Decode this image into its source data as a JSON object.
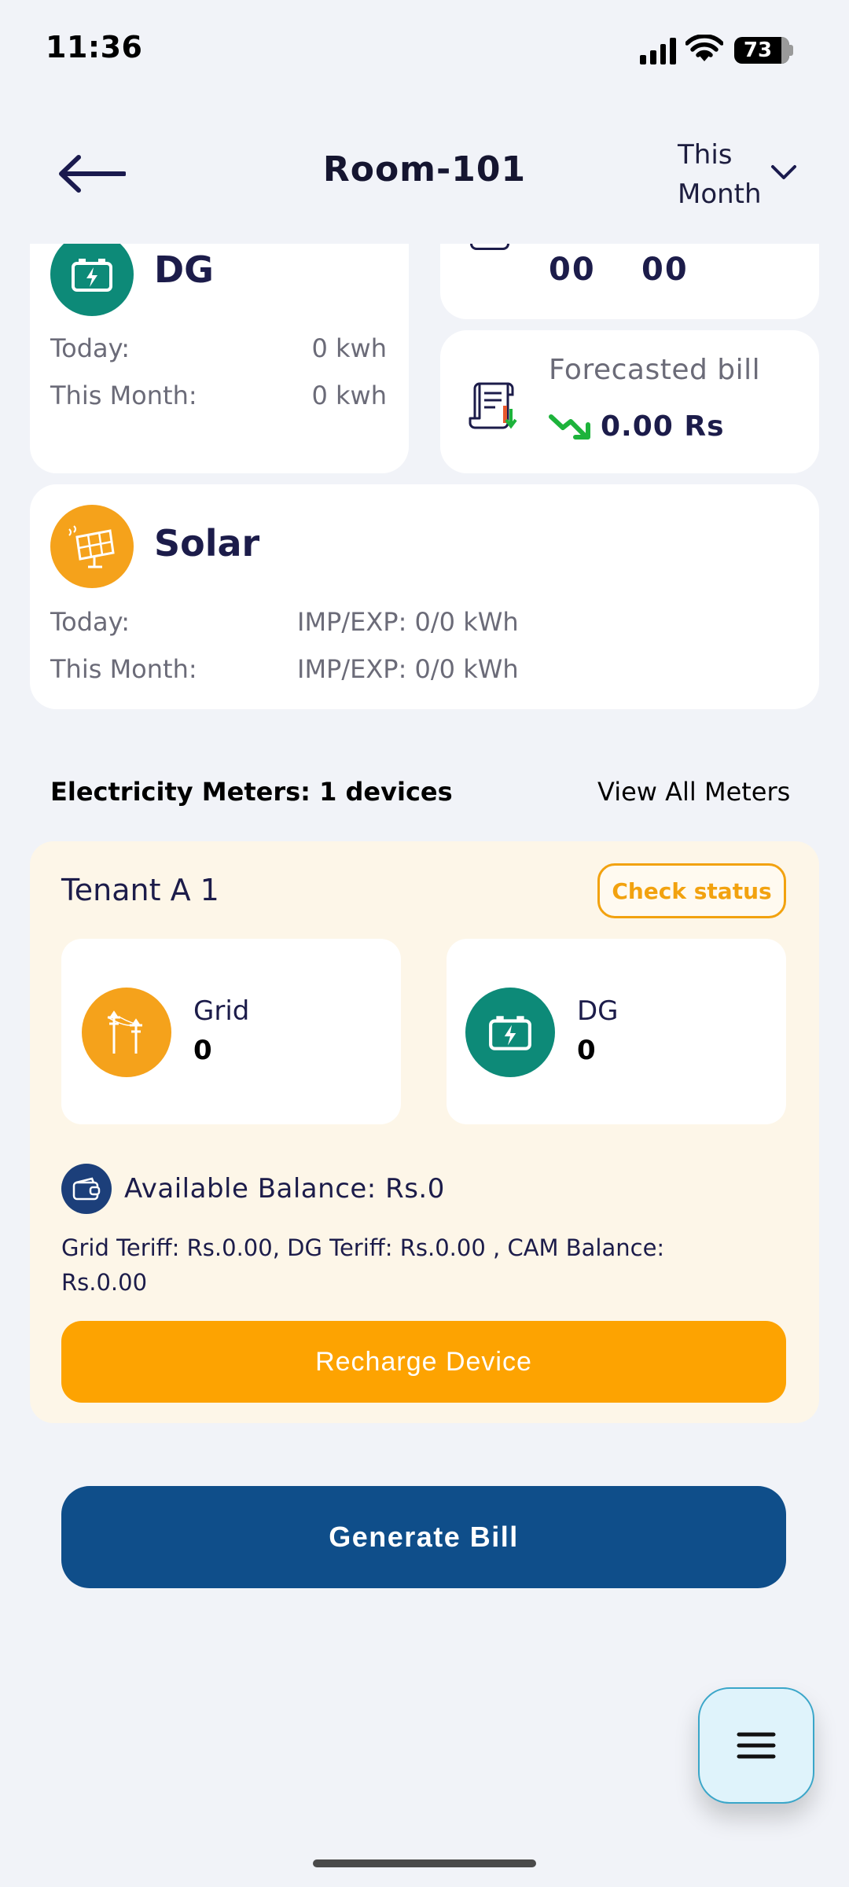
{
  "status_bar": {
    "time": "11:36",
    "battery": "73"
  },
  "header": {
    "title": "Room-101",
    "period_line1": "This",
    "period_line2": "Month"
  },
  "dg_card": {
    "title": "DG",
    "rows": [
      {
        "label": "Today:",
        "value": "0 kwh"
      },
      {
        "label": "This Month:",
        "value": "0 kwh"
      }
    ]
  },
  "partial_card": {
    "value_a": "00",
    "value_b": "00"
  },
  "forecast_card": {
    "label": "Forecasted bill",
    "value": "0.00 Rs"
  },
  "solar_card": {
    "title": "Solar",
    "rows": [
      {
        "label": "Today:",
        "value": "IMP/EXP: 0/0 kWh"
      },
      {
        "label": "This Month:",
        "value": "IMP/EXP: 0/0 kWh"
      }
    ]
  },
  "meters_section": {
    "heading": "Electricity Meters: 1 devices",
    "view_all": "View All Meters"
  },
  "tenant": {
    "name": "Tenant A 1",
    "check_status": "Check status",
    "grid": {
      "label": "Grid",
      "value": "0"
    },
    "dg": {
      "label": "DG",
      "value": "0"
    },
    "balance": "Available Balance: Rs.0",
    "tariff_line1": "Grid Teriff: Rs.0.00, DG Teriff: Rs.0.00 , CAM Balance:",
    "tariff_line2": "Rs.0.00",
    "recharge": "Recharge Device"
  },
  "generate_bill": "Generate Bill",
  "colors": {
    "teal": "#0d8a78",
    "orange": "#f5a21b",
    "navy_button": "#0f4e8a",
    "recharge_orange": "#fda301",
    "trend_green": "#1db33b"
  }
}
